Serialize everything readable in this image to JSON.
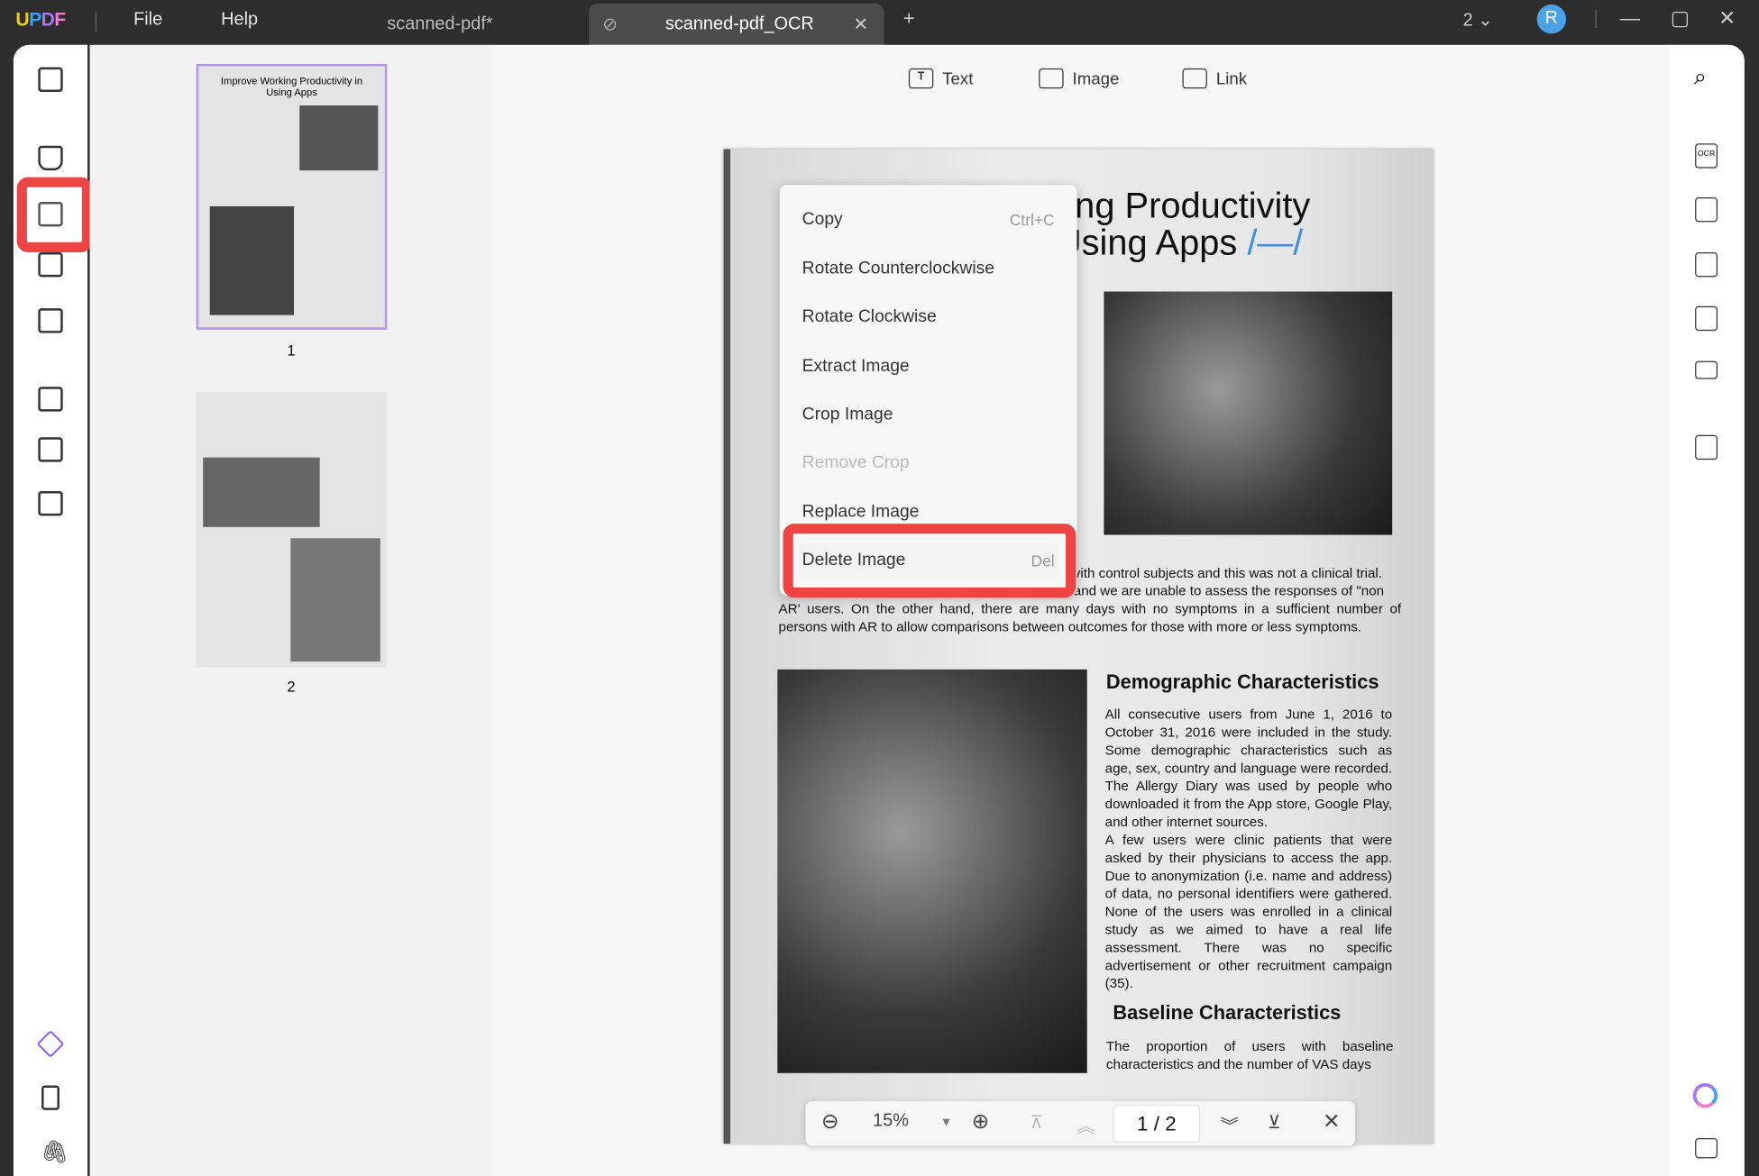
{
  "titlebar": {
    "logo": "UPDF",
    "menus": [
      "File",
      "Help"
    ],
    "tabs": [
      {
        "label": "scanned-pdf*",
        "active": false
      },
      {
        "label": "scanned-pdf_OCR",
        "active": true
      }
    ],
    "new_tab": "+",
    "window_count": "2",
    "avatar_initial": "R",
    "accent": "#4aa3e8"
  },
  "toolbar": {
    "text": "Text",
    "image": "Image",
    "link": "Link"
  },
  "thumbnails": [
    {
      "page": "1",
      "title": "Improve Working Productivity in Using Apps"
    },
    {
      "page": "2"
    }
  ],
  "document": {
    "title_line1": "ing Productivity",
    "title_line2": "Using Apps",
    "title_mark": "/—/",
    "para1_line1": "vith control subjects and this was not a clinical trial.",
    "para1_line2": "and we are unable to assess the responses of \"non",
    "para1_rest": "AR' users. On the other hand, there are many days with no symptoms in a sufficient number of persons with AR to allow comparisons between outcomes for those with more or less symptoms.",
    "heading1": "Demographic Characteristics",
    "body1": "All consecutive users from June 1, 2016 to October 31, 2016 were included in the study. Some demographic characteristics such as age, sex, country and language were recorded. The Allergy Diary was used by people who downloaded it from the App store, Google Play, and other internet sources.",
    "body2": "A few users were clinic patients that were asked by their physicians to access the app. Due to anonymization (i.e. name and address) of data, no personal identifiers were gathered. None of the users was enrolled in a clinical study as we aimed to have a real life assessment. There was no specific advertisement or other recruitment campaign (35).",
    "heading2": "Baseline Characteristics",
    "body3": "The proportion of users with baseline characteristics and the number of VAS days"
  },
  "context_menu": {
    "items": [
      {
        "label": "Copy",
        "shortcut": "Ctrl+C"
      },
      {
        "label": "Rotate Counterclockwise"
      },
      {
        "label": "Rotate Clockwise"
      },
      {
        "label": "Extract Image"
      },
      {
        "label": "Crop Image"
      },
      {
        "label": "Remove Crop",
        "disabled": true
      },
      {
        "label": "Replace Image"
      },
      {
        "label": "Delete Image",
        "shortcut": "Del",
        "highlighted": true
      }
    ]
  },
  "bottom_bar": {
    "zoom": "15%",
    "page_current": "1",
    "page_sep": "/",
    "page_total": "2"
  },
  "highlight_color": "#ef4444"
}
